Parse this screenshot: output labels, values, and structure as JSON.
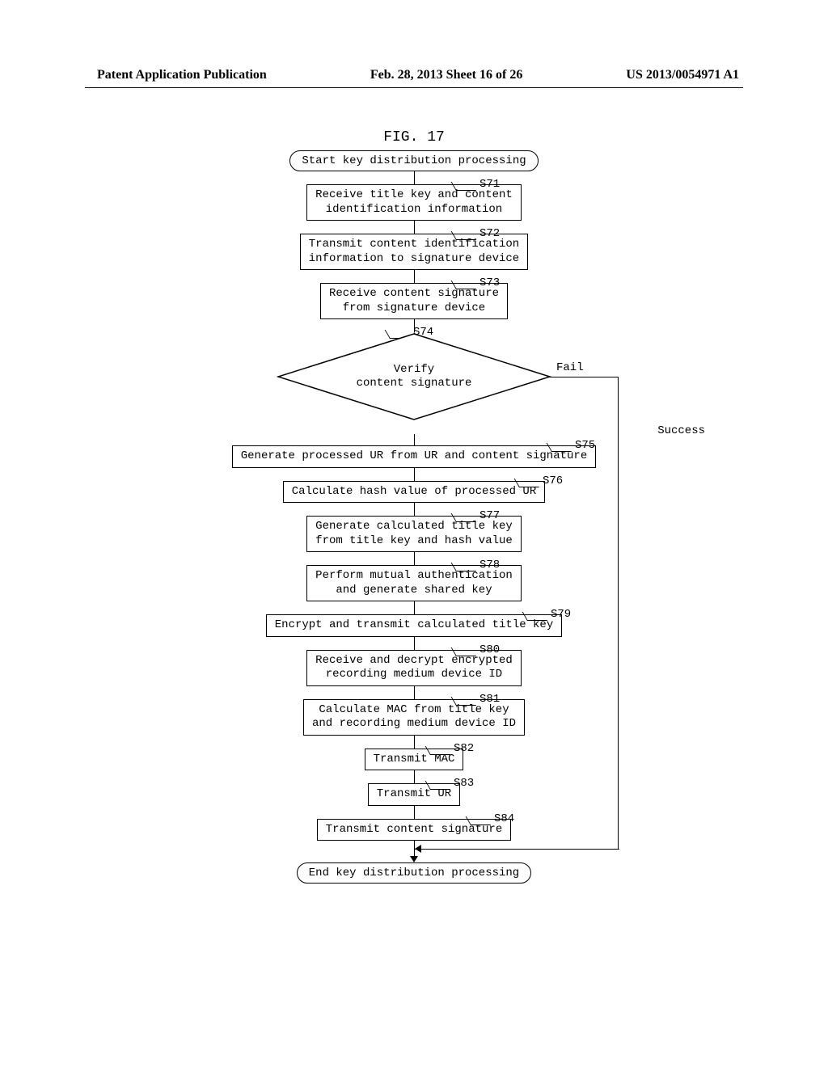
{
  "header": {
    "left": "Patent Application Publication",
    "center": "Feb. 28, 2013  Sheet 16 of 26",
    "right": "US 2013/0054971 A1"
  },
  "figure_label": "FIG. 17",
  "flow": {
    "start": "Start key distribution processing",
    "end": "End key distribution processing",
    "steps": {
      "s71": {
        "id": "S71",
        "text": "Receive title key and content\nidentification information"
      },
      "s72": {
        "id": "S72",
        "text": "Transmit content identification\ninformation to signature device"
      },
      "s73": {
        "id": "S73",
        "text": "Receive content signature\nfrom signature device"
      },
      "s74": {
        "id": "S74",
        "text": "Verify\ncontent signature",
        "yes": "Success",
        "no": "Fail"
      },
      "s75": {
        "id": "S75",
        "text": "Generate processed UR from UR and content signature"
      },
      "s76": {
        "id": "S76",
        "text": "Calculate hash value of processed UR"
      },
      "s77": {
        "id": "S77",
        "text": "Generate calculated title key\nfrom title key and hash value"
      },
      "s78": {
        "id": "S78",
        "text": "Perform mutual authentication\nand generate shared key"
      },
      "s79": {
        "id": "S79",
        "text": "Encrypt and transmit calculated title key"
      },
      "s80": {
        "id": "S80",
        "text": "Receive and decrypt encrypted\nrecording medium device ID"
      },
      "s81": {
        "id": "S81",
        "text": "Calculate MAC from title key\nand recording medium device ID"
      },
      "s82": {
        "id": "S82",
        "text": "Transmit MAC"
      },
      "s83": {
        "id": "S83",
        "text": "Transmit UR"
      },
      "s84": {
        "id": "S84",
        "text": "Transmit content signature"
      }
    }
  }
}
